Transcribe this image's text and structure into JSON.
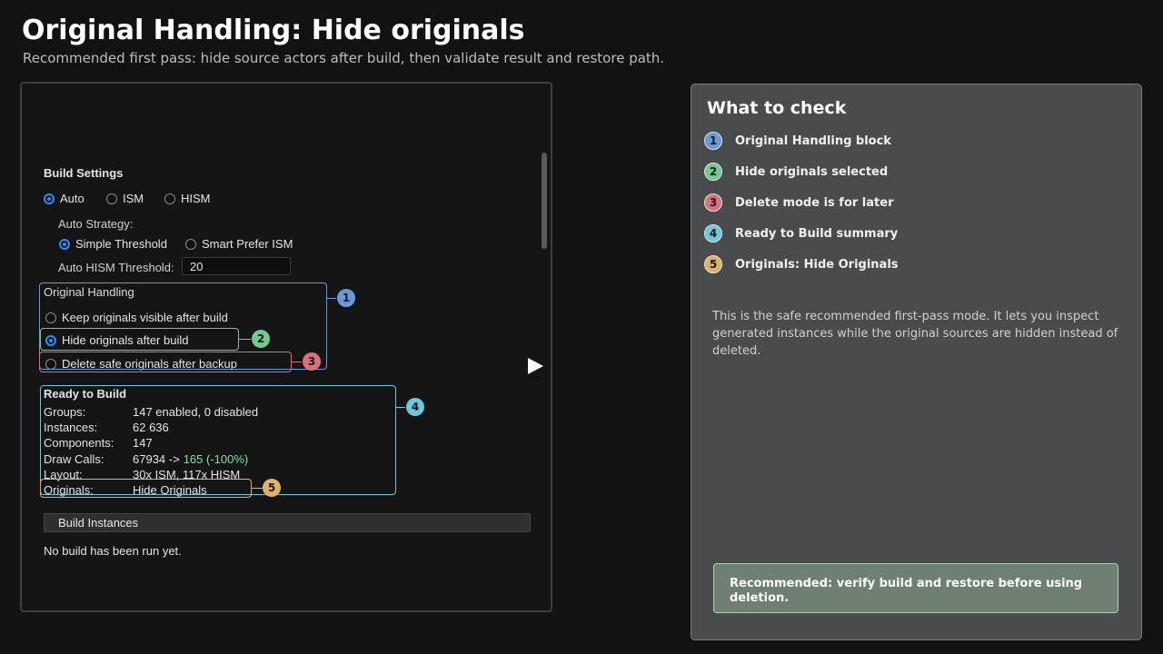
{
  "header": {
    "title": "Original Handling: Hide originals",
    "subtitle": "Recommended first pass: hide source actors after build, then validate result and restore path."
  },
  "build_settings": {
    "title": "Build Settings",
    "modes": [
      {
        "label": "Auto",
        "selected": true
      },
      {
        "label": "ISM",
        "selected": false
      },
      {
        "label": "HISM",
        "selected": false
      }
    ],
    "auto_strategy_label": "Auto Strategy:",
    "strategies": [
      {
        "label": "Simple Threshold",
        "selected": true
      },
      {
        "label": "Smart Prefer ISM",
        "selected": false
      }
    ],
    "hism_threshold_label": "Auto HISM Threshold:",
    "hism_threshold_value": "20"
  },
  "original_handling": {
    "title": "Original Handling",
    "options": [
      {
        "label": "Keep originals visible after build",
        "selected": false
      },
      {
        "label": "Hide originals after build",
        "selected": true
      },
      {
        "label": "Delete safe originals after backup",
        "selected": false
      }
    ]
  },
  "ready_to_build": {
    "title": "Ready to Build",
    "rows": [
      {
        "key": "Groups:",
        "value": "147 enabled, 0 disabled"
      },
      {
        "key": "Instances:",
        "value": "62 636"
      },
      {
        "key": "Components:",
        "value": "147"
      },
      {
        "key": "Draw Calls:",
        "value_before": "67934 ->",
        "value_after": "165  (-100%)"
      },
      {
        "key": "Layout:",
        "value": "30x ISM, 117x HISM"
      },
      {
        "key": "Originals:",
        "value": "Hide Originals"
      }
    ]
  },
  "build_button_label": "Build Instances",
  "build_status": "No build has been run yet.",
  "callouts": [
    "1",
    "2",
    "3",
    "4",
    "5"
  ],
  "info_panel": {
    "title": "What to check",
    "items": [
      {
        "num": "1",
        "label": "Original Handling block",
        "color": "#6a9bd8"
      },
      {
        "num": "2",
        "label": "Hide originals selected",
        "color": "#6fcb8f"
      },
      {
        "num": "3",
        "label": "Delete mode is for later",
        "color": "#d9707a"
      },
      {
        "num": "4",
        "label": "Ready to Build summary",
        "color": "#6fc6de"
      },
      {
        "num": "5",
        "label": "Originals: Hide Originals",
        "color": "#e0b266"
      }
    ],
    "body": "This is the safe recommended first-pass mode. It lets you inspect generated instances while the original sources are hidden instead of deleted.",
    "recommendation": "Recommended: verify build and restore before using deletion."
  },
  "colors": {
    "callout_1": "#6a9bd8",
    "callout_2": "#6fcb8f",
    "callout_3": "#d9707a",
    "callout_4": "#6fc6de",
    "callout_5": "#e0b266",
    "radio_selected": "#2d8cff",
    "draw_calls_after": "#7fe0a8"
  }
}
